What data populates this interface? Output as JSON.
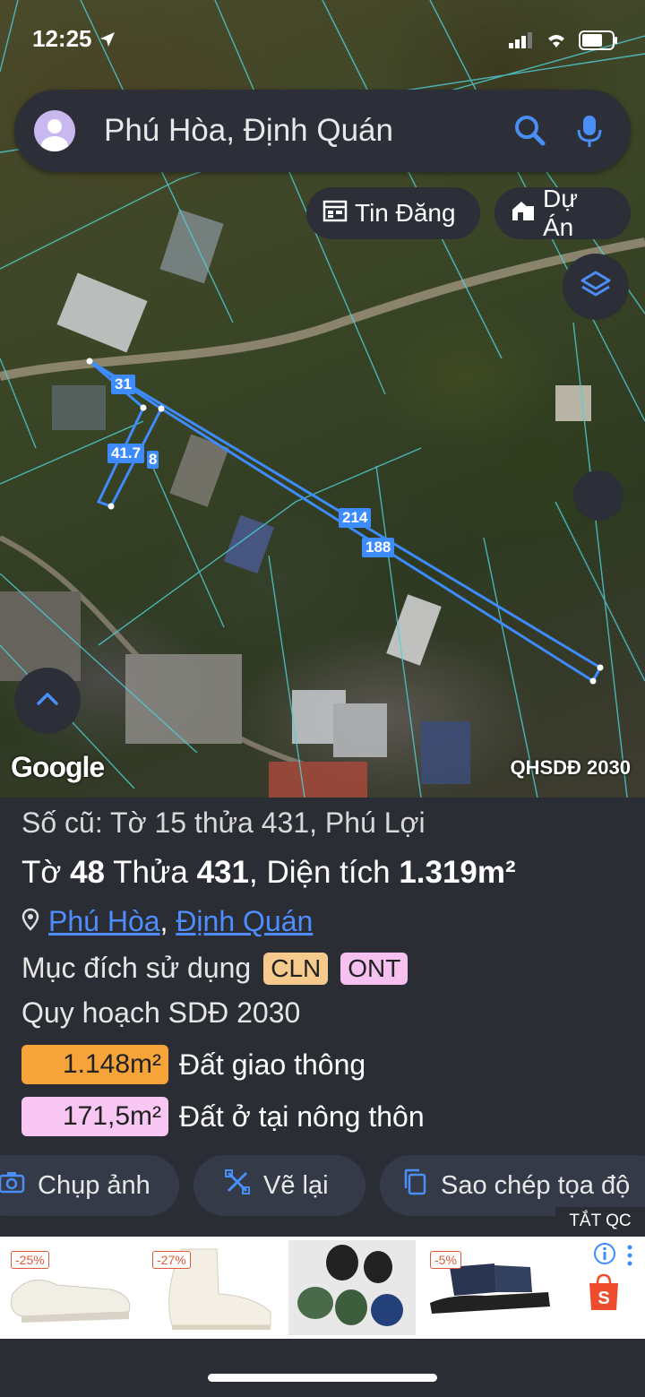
{
  "status_bar": {
    "time": "12:25"
  },
  "search": {
    "query": "Phú Hòa, Định Quán"
  },
  "chips": {
    "listing": "Tin Đăng",
    "project": "Dự Án"
  },
  "map": {
    "edge_labels": [
      "31",
      "41.7",
      "8",
      "214",
      "188"
    ],
    "attribution": "Google",
    "layer_name": "QHSDĐ 2030"
  },
  "parcel": {
    "old_info": "Số cũ: Tờ 15 thửa 431, Phú Lợi",
    "sheet_label": "Tờ",
    "sheet": "48",
    "plot_label": "Thửa",
    "plot": "431",
    "area_label": "Diện tích",
    "area": "1.319m²",
    "ward": "Phú Hòa",
    "district": "Định Quán",
    "purpose_label": "Mục đích sử dụng",
    "purpose_tags": [
      "CLN",
      "ONT"
    ],
    "plan_label": "Quy hoạch SDĐ 2030",
    "zones": [
      {
        "area": "1.148m²",
        "name": "Đất giao thông",
        "color": "#f6a43a"
      },
      {
        "area": "171,5m²",
        "name": "Đất ở tại nông thôn",
        "color": "#f7c6f2"
      }
    ]
  },
  "actions": {
    "photo": "Chụp ảnh",
    "redraw": "Vẽ lại",
    "copy": "Sao chép tọa độ"
  },
  "ad": {
    "label": "TẮT QC",
    "discounts": [
      "-25%",
      "-27%",
      "-5%"
    ]
  },
  "colors": {
    "accent": "#3d8bfd",
    "panel": "#2b2d34",
    "cln": "#f6c98c",
    "ont": "#f6c1f0"
  }
}
